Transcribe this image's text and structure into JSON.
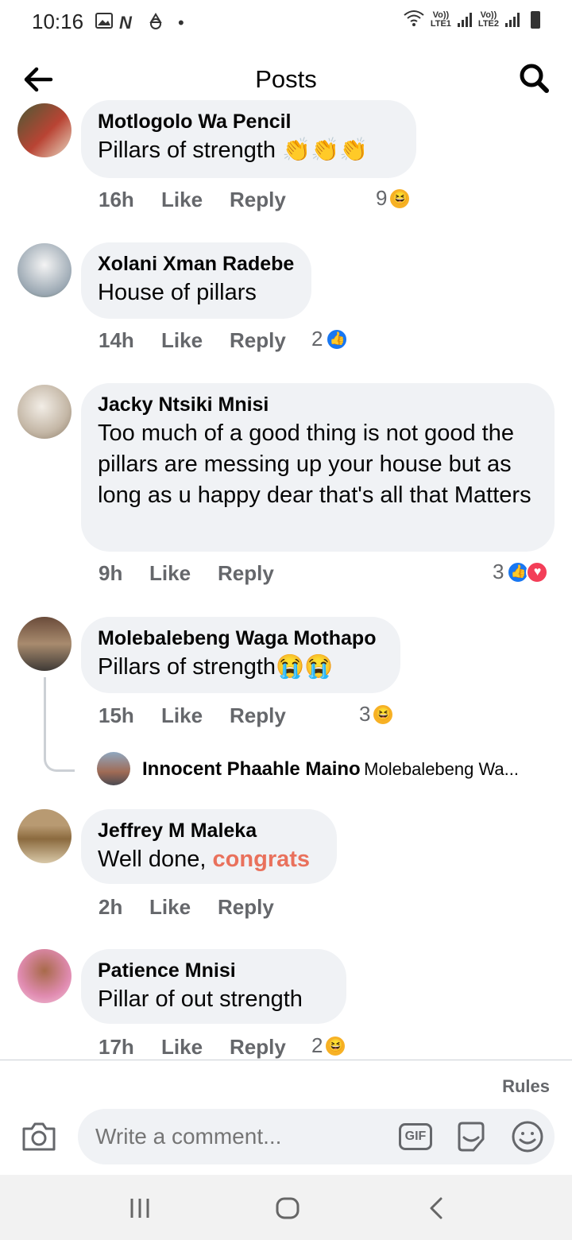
{
  "status_bar": {
    "time": "10:16",
    "icons": [
      "gallery-icon",
      "n-icon",
      "recycle-icon",
      "dot-icon"
    ],
    "sim1": "Vo))\nLTE1",
    "sim2": "Vo))\nLTE2"
  },
  "header": {
    "title": "Posts"
  },
  "comments": [
    {
      "name": "Motlogolo Wa Pencil",
      "text": "Pillars of strength 👏👏👏",
      "time": "16h",
      "like": "Like",
      "reply": "Reply",
      "reactions": "9",
      "reaction_types": [
        "haha"
      ]
    },
    {
      "name": "Xolani Xman Radebe",
      "text": "House of pillars",
      "time": "14h",
      "like": "Like",
      "reply": "Reply",
      "reactions": "2",
      "reaction_types": [
        "like"
      ]
    },
    {
      "name": "Jacky Ntsiki Mnisi",
      "text": "Too much of a good thing is not good the pillars are messing up your house but as long as u happy dear that's all that Matters",
      "time": "9h",
      "like": "Like",
      "reply": "Reply",
      "reactions": "3",
      "reaction_types": [
        "like",
        "love"
      ]
    },
    {
      "name": "Molebalebeng Waga Mothapo",
      "text": "Pillars of strength😭😭",
      "time": "15h",
      "like": "Like",
      "reply": "Reply",
      "reactions": "3",
      "reaction_types": [
        "haha"
      ]
    },
    {
      "name": "Jeffrey M Maleka",
      "text_prefix": "Well done, ",
      "text_link": "congrats",
      "time": "2h",
      "like": "Like",
      "reply": "Reply"
    },
    {
      "name": "Patience Mnisi",
      "text": "Pillar of out strength",
      "time": "17h",
      "like": "Like",
      "reply": "Reply",
      "reactions": "2",
      "reaction_types": [
        "haha"
      ]
    }
  ],
  "reply_preview": {
    "name": "Innocent Phaahle Maino",
    "snippet": "Molebalebeng Wa..."
  },
  "composer": {
    "rules": "Rules",
    "placeholder": "Write a comment...",
    "gif": "GIF"
  },
  "colors": {
    "bubble": "#f0f2f5",
    "meta": "#65676b",
    "link": "#e9715c",
    "like": "#1877f2",
    "love": "#f33e58"
  }
}
